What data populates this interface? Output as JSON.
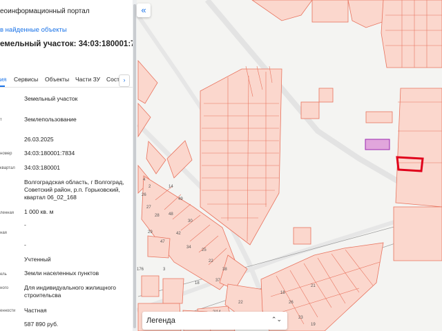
{
  "panel": {
    "portal_title": "еоинформационный портал",
    "found_link": "в найденные объекты",
    "parcel_title": "емельный участок: 34:03:180001:7834",
    "tabs": [
      "ия",
      "Сервисы",
      "Объекты",
      "Части ЗУ",
      "Сост"
    ],
    "tabs_next": "›",
    "rows": [
      {
        "label": "",
        "value": "Земельный участок"
      },
      {
        "label": "т",
        "value": "Землепользование"
      },
      {
        "label": "",
        "value": "26.03.2025"
      },
      {
        "label": "номер",
        "value": "34:03:180001:7834"
      },
      {
        "label": "квартал",
        "value": "34:03:180001"
      },
      {
        "label": "",
        "value": "Волгоградская область, г Волгоград, Советский район, р.п. Горьковский, квартал 06_02_168"
      },
      {
        "label": "ленная",
        "value": "1 000 кв. м"
      },
      {
        "label": "",
        "value": "-"
      },
      {
        "label": "ная",
        "value": ""
      },
      {
        "label": "",
        "value": "-"
      },
      {
        "label": "",
        "value": "Учтенный"
      },
      {
        "label": "ель",
        "value": "Земли населенных пунктов"
      },
      {
        "label": "ного",
        "value": "Для индивидуального жилищного строительсва"
      },
      {
        "label": "енности",
        "value": "Частная"
      },
      {
        "label": "",
        "value": "587 890 руб."
      }
    ]
  },
  "map": {
    "collapse_label": "«",
    "legend_label": "Легенда",
    "legend_arrow": "⌃⌄",
    "parcel_numbers": [
      "4",
      "2",
      "26",
      "14",
      "49",
      "48",
      "42",
      "30",
      "27",
      "28",
      "29",
      "47",
      "34",
      "25",
      "22",
      "37",
      "38",
      "176",
      "18",
      "3",
      "2/14",
      "22",
      "19",
      "18",
      "26",
      "21",
      "23",
      "19"
    ],
    "colors": {
      "parcel_fill": "#fbd7cd",
      "parcel_stroke": "#e8735e",
      "selected_stroke": "#e0001b",
      "purple_fill": "#e1a6dc",
      "purple_stroke": "#9c27b0",
      "accent": "#1a73e8"
    }
  }
}
